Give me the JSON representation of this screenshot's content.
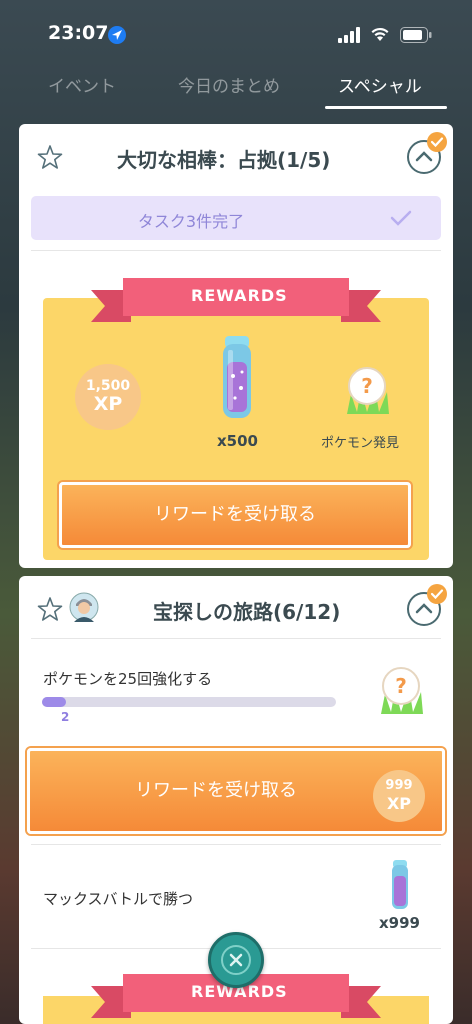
{
  "status": {
    "time": "23:07"
  },
  "tabs": [
    {
      "label": "イベント"
    },
    {
      "label": "今日のまとめ"
    },
    {
      "label": "スペシャル"
    }
  ],
  "card1": {
    "title": "大切な相棒：占拠(1/5)",
    "done_text": "タスク3件完了",
    "rewards_label": "REWARDS",
    "xp_value": "1,500",
    "xp_unit": "XP",
    "item_count": "x500",
    "encounter_label": "ポケモン発見",
    "claim_label": "リワードを受け取る"
  },
  "card2": {
    "title": "宝探しの旅路(6/12)",
    "task1_text": "ポケモンを25回強化する",
    "task1_progress": 2,
    "task1_total": 25,
    "claim_label": "リワードを受け取る",
    "xp_value": "999",
    "xp_unit": "XP",
    "task2_text": "マックスバトルで勝つ",
    "task2_item_count": "x999",
    "rewards_label": "REWARDS"
  },
  "colors": {
    "reward_panel": "#fcd668",
    "ribbon": "#f2607a",
    "claim_button": "#f58a38",
    "done_bar": "#e8e2fb",
    "fab": "#2a9a93"
  }
}
